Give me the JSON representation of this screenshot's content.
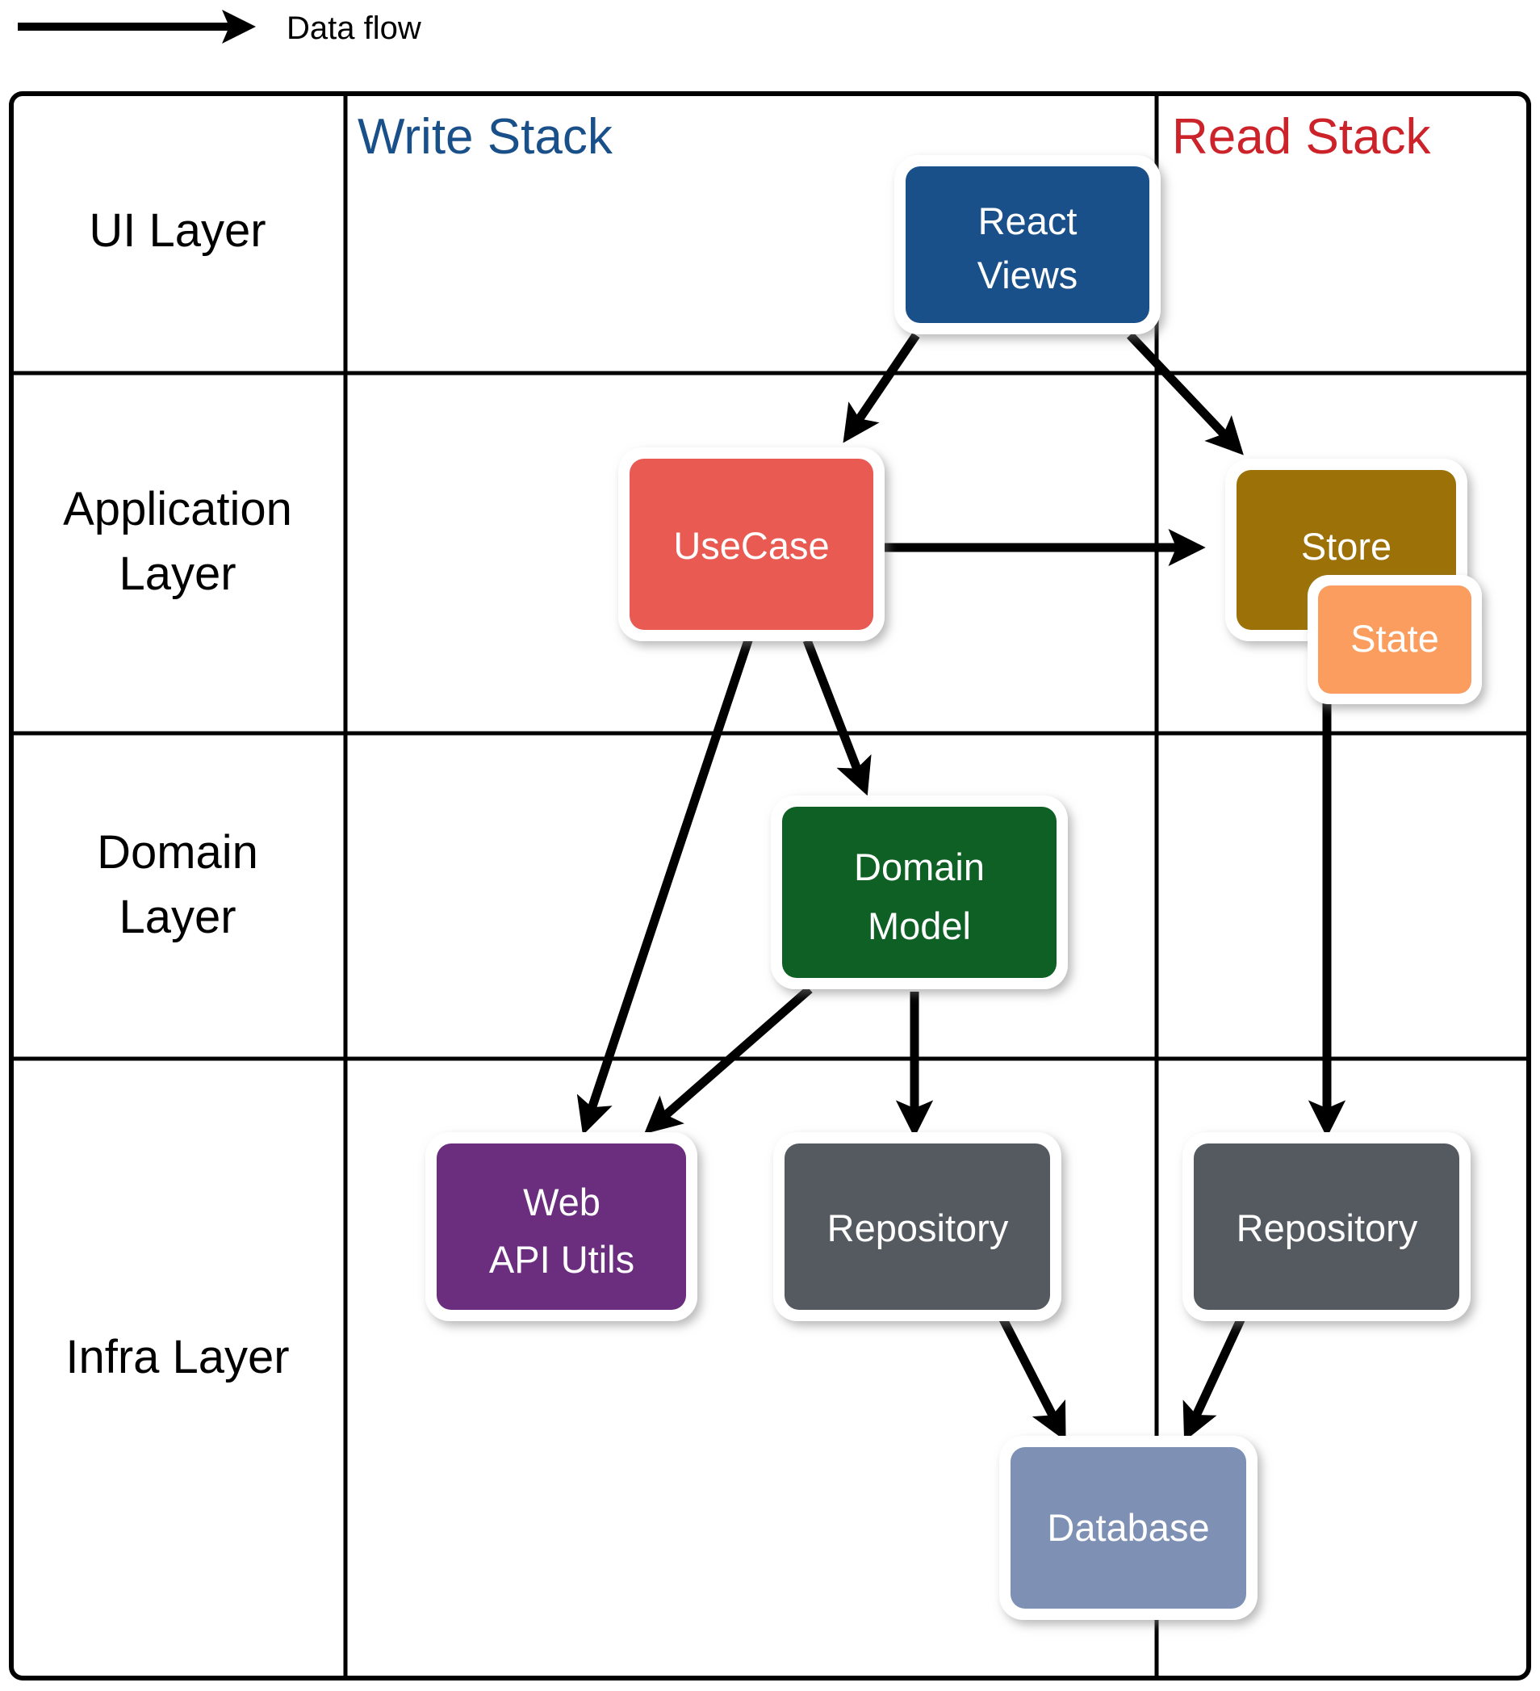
{
  "legend": {
    "arrow_label": "Data flow"
  },
  "columns": [
    {
      "id": "row-label-col",
      "label": ""
    },
    {
      "id": "write-stack",
      "label": "Write Stack",
      "color": "#1A5089"
    },
    {
      "id": "read-stack",
      "label": "Read Stack",
      "color": "#CC2229"
    }
  ],
  "rows": [
    {
      "id": "ui-layer",
      "label": "UI Layer",
      "lines": [
        "UI Layer"
      ]
    },
    {
      "id": "application-layer",
      "label": "Application Layer",
      "lines": [
        "Application",
        "Layer"
      ]
    },
    {
      "id": "domain-layer",
      "label": "Domain Layer",
      "lines": [
        "Domain",
        "Layer"
      ]
    },
    {
      "id": "infra-layer",
      "label": "Infra Layer",
      "lines": [
        "Infra Layer"
      ]
    }
  ],
  "nodes": [
    {
      "id": "react-views",
      "lines": [
        "React",
        "Views"
      ],
      "color": "#1A5089",
      "row": "ui-layer",
      "column": "write-stack"
    },
    {
      "id": "usecase",
      "lines": [
        "UseCase"
      ],
      "color": "#E85A52",
      "row": "application-layer",
      "column": "write-stack"
    },
    {
      "id": "store",
      "lines": [
        "Store"
      ],
      "color": "#9C7208",
      "row": "application-layer",
      "column": "read-stack"
    },
    {
      "id": "state",
      "lines": [
        "State"
      ],
      "color": "#FA9D5F",
      "row": "application-layer",
      "column": "read-stack"
    },
    {
      "id": "domain-model",
      "lines": [
        "Domain",
        "Model"
      ],
      "color": "#0F6025",
      "row": "domain-layer",
      "column": "write-stack"
    },
    {
      "id": "web-api-utils",
      "lines": [
        "Web",
        "API Utils"
      ],
      "color": "#6B2D7E",
      "row": "infra-layer",
      "column": "write-stack"
    },
    {
      "id": "repository-write",
      "lines": [
        "Repository"
      ],
      "color": "#555A60",
      "row": "infra-layer",
      "column": "write-stack"
    },
    {
      "id": "repository-read",
      "lines": [
        "Repository"
      ],
      "color": "#555A60",
      "row": "infra-layer",
      "column": "read-stack"
    },
    {
      "id": "database",
      "lines": [
        "Database"
      ],
      "color": "#7E90B4",
      "row": "infra-layer",
      "column": "write-stack"
    }
  ],
  "edges": [
    {
      "id": "react-views-to-usecase",
      "from": "react-views",
      "to": "usecase"
    },
    {
      "id": "react-views-to-store",
      "from": "react-views",
      "to": "store"
    },
    {
      "id": "usecase-to-store",
      "from": "usecase",
      "to": "store"
    },
    {
      "id": "usecase-to-web-api-utils",
      "from": "usecase",
      "to": "web-api-utils"
    },
    {
      "id": "usecase-to-domain-model",
      "from": "usecase",
      "to": "domain-model"
    },
    {
      "id": "state-to-repository-read",
      "from": "state",
      "to": "repository-read"
    },
    {
      "id": "domain-model-to-web-api-utils",
      "from": "domain-model",
      "to": "web-api-utils"
    },
    {
      "id": "domain-model-to-repository-write",
      "from": "domain-model",
      "to": "repository-write"
    },
    {
      "id": "repository-write-to-database",
      "from": "repository-write",
      "to": "database"
    },
    {
      "id": "repository-read-to-database",
      "from": "repository-read",
      "to": "database"
    }
  ]
}
